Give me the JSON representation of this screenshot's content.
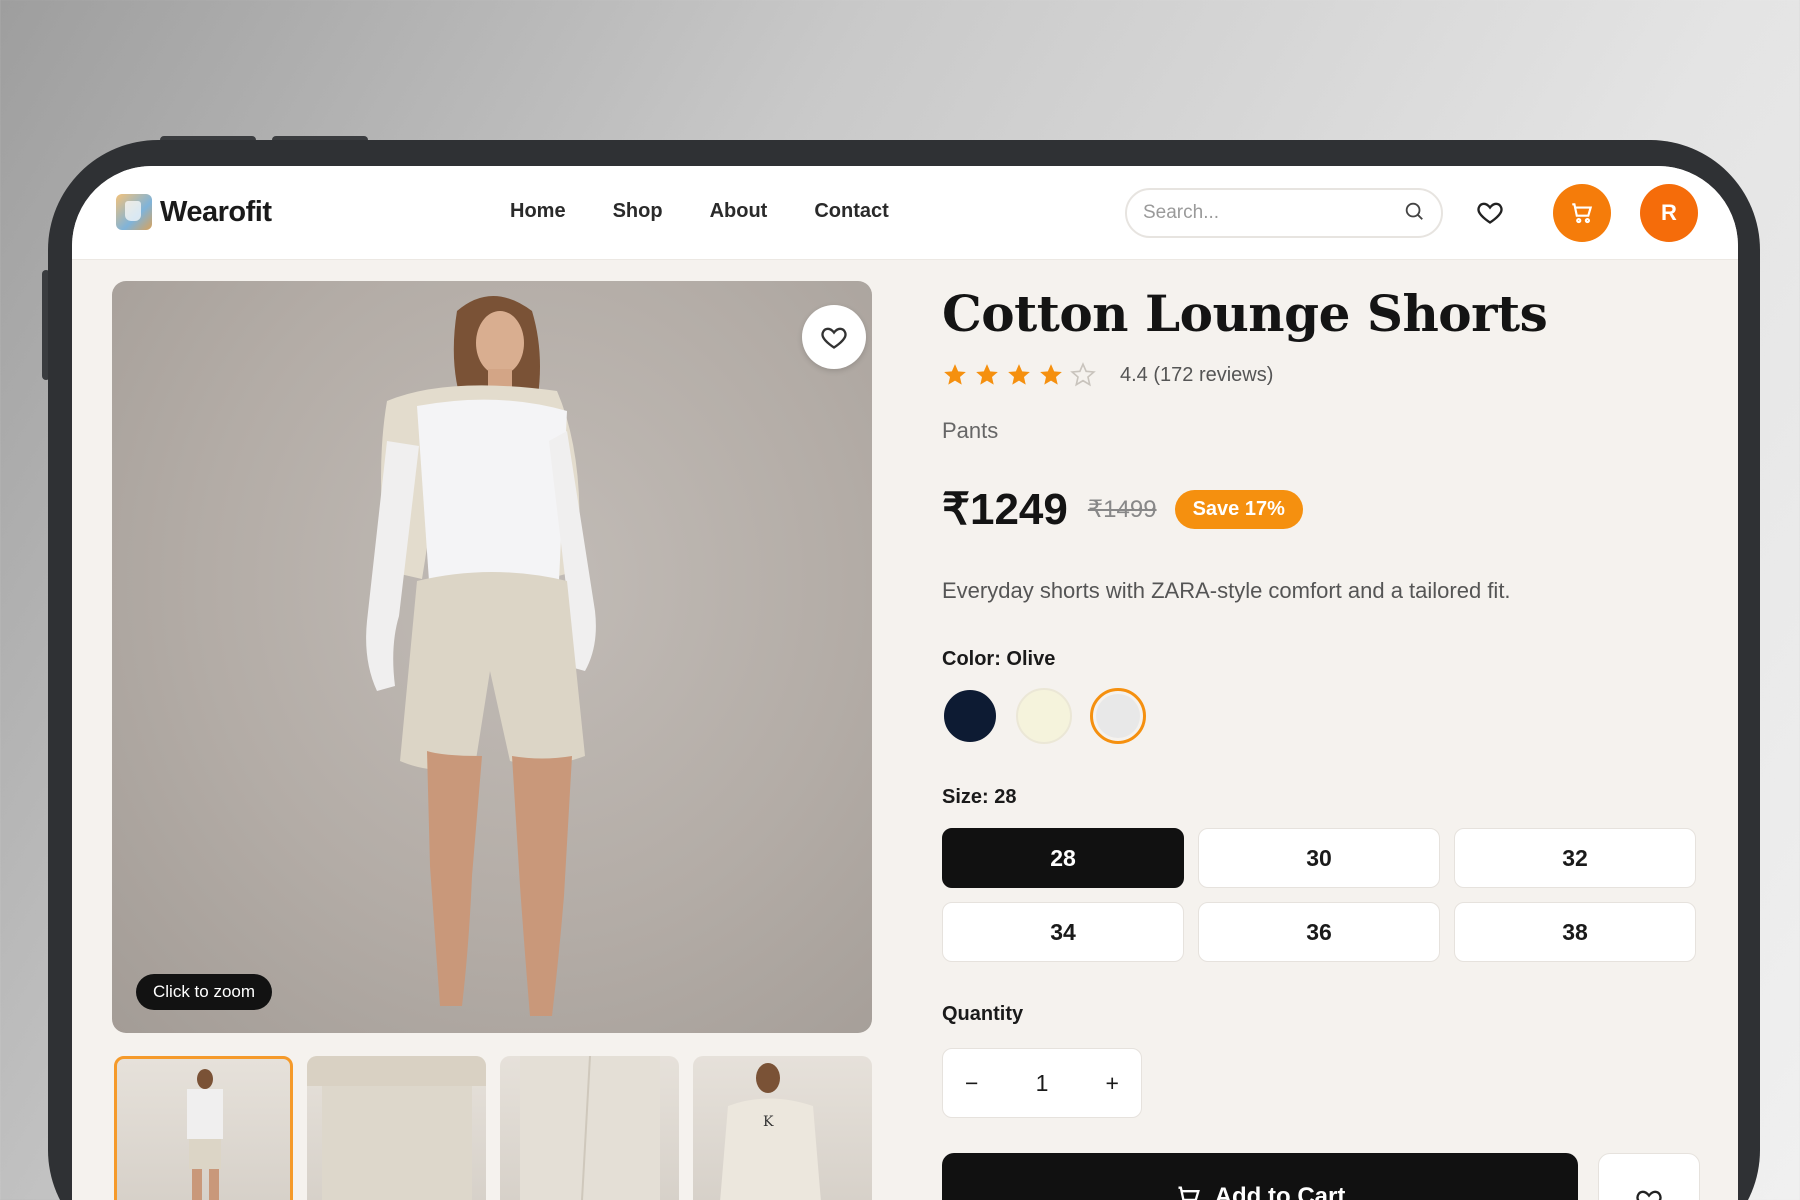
{
  "header": {
    "logo_text": "Wearofit",
    "nav": [
      "Home",
      "Shop",
      "About",
      "Contact"
    ],
    "search_placeholder": "Search...",
    "avatar_initial": "R"
  },
  "gallery": {
    "zoom_hint": "Click to zoom",
    "thumbnail_count": 4,
    "active_thumbnail": 1
  },
  "product": {
    "title": "Cotton Lounge Shorts",
    "rating": 4.4,
    "rating_text": "4.4 (172 reviews)",
    "category": "Pants",
    "price": "₹1249",
    "old_price": "₹1499",
    "save_badge": "Save 17%",
    "description": "Everyday shorts with ZARA-style comfort and a tailored fit.",
    "color_label": "Color: Olive",
    "colors": [
      "#0d1b33",
      "#f5f3dc",
      "#e8e8e8"
    ],
    "selected_color_index": 2,
    "size_label": "Size: 28",
    "sizes": [
      "28",
      "30",
      "32",
      "34",
      "36",
      "38"
    ],
    "selected_size": "28",
    "quantity_label": "Quantity",
    "quantity": "1",
    "qty_minus": "−",
    "qty_plus": "+",
    "add_to_cart": "Add to Cart"
  },
  "colors": {
    "accent": "#f57c0a",
    "dark": "#111111",
    "page_bg": "#f5f2ee"
  }
}
